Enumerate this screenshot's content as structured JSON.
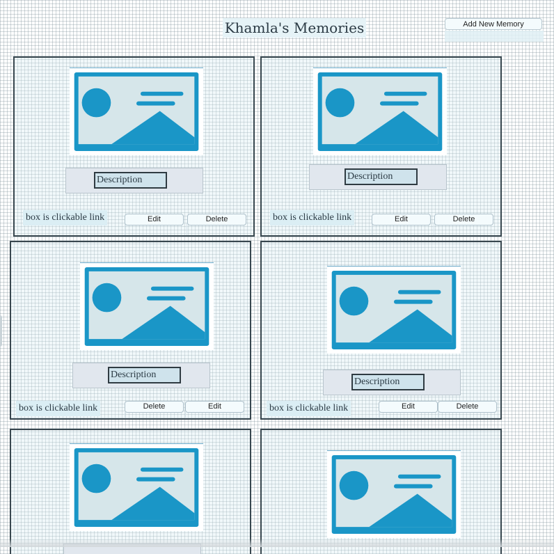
{
  "header": {
    "title": "Khamla's Memories",
    "add_button_label": "Add New Memory"
  },
  "cards": [
    {
      "description": "Description",
      "link_text": "box is clickable link",
      "buttons": [
        "Edit",
        "Delete"
      ]
    },
    {
      "description": "Description",
      "link_text": "box is clickable link",
      "buttons": [
        "Edit",
        "Delete"
      ]
    },
    {
      "description": "Description",
      "link_text": "box is clickable link",
      "buttons": [
        "Delete",
        "Edit"
      ]
    },
    {
      "description": "Description",
      "link_text": "box is clickable link",
      "buttons": [
        "Edit",
        "Delete"
      ]
    },
    {
      "description": "",
      "link_text": "",
      "buttons": []
    },
    {
      "description": "",
      "link_text": "",
      "buttons": []
    }
  ],
  "icons": {
    "placeholder": "image-placeholder-icon"
  },
  "colors": {
    "icon_blue": "#1a96c7",
    "icon_bg": "#d6e6ea",
    "card_border": "#38474f"
  }
}
